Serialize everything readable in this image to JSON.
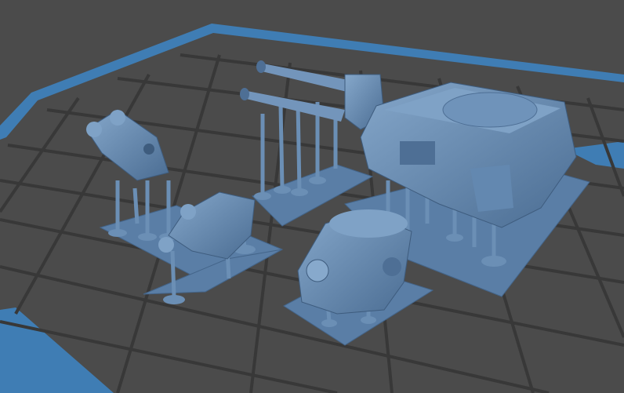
{
  "scene": {
    "colors": {
      "background": "#4b4b4b",
      "grid_line": "#3b3b3b",
      "plate_border": "#3f7db4",
      "model": "#5b80a8",
      "model_light": "#7fa2c6",
      "model_dark": "#3e5c7e",
      "base": "#5a7ea6"
    }
  }
}
